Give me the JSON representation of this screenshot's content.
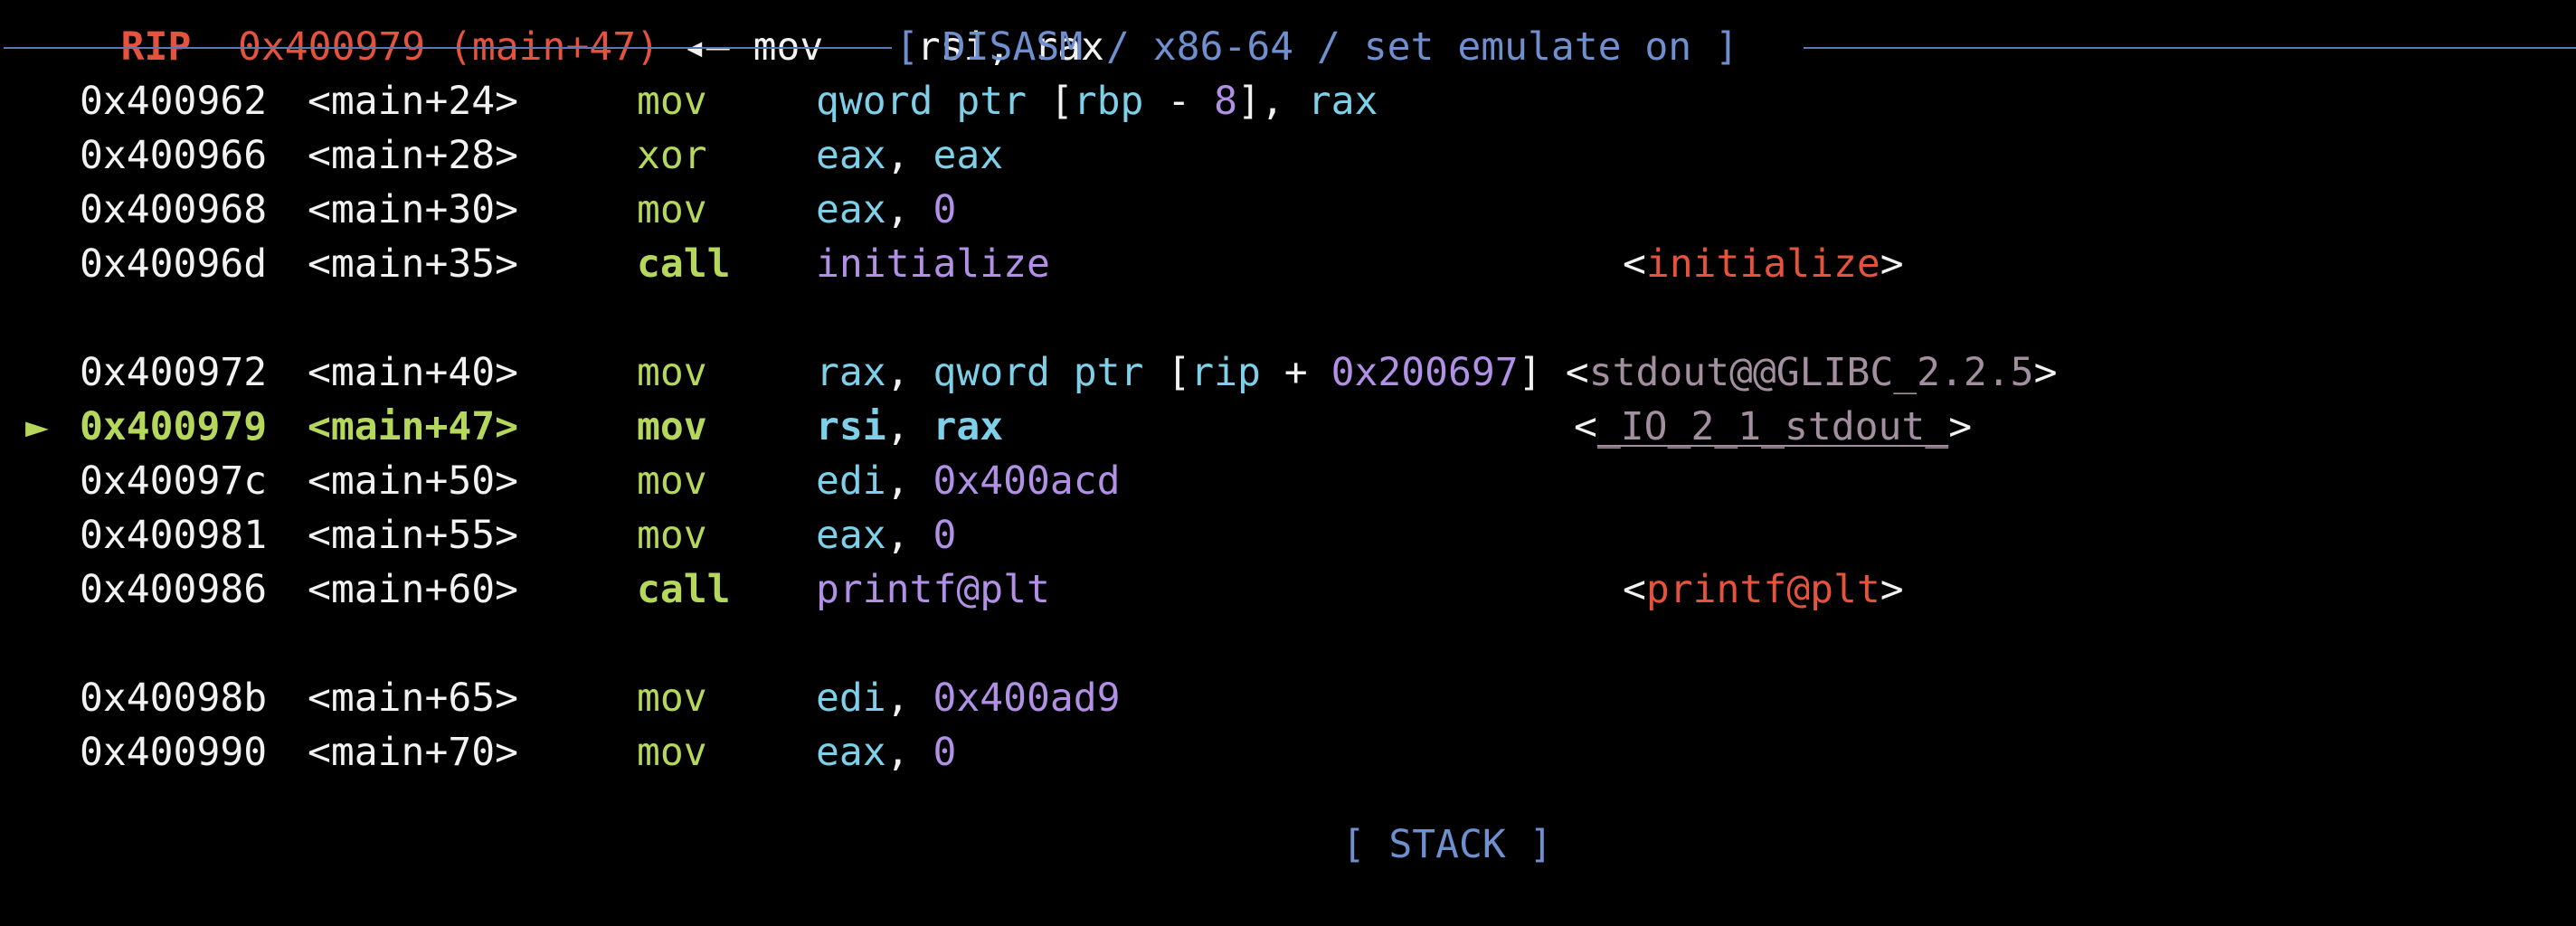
{
  "top_partial": {
    "reg": "RIP",
    "addr_sym": "0x400979 (main+47)",
    "arrow": "◂—",
    "instr": "mov    rsi, rax"
  },
  "banner": {
    "title": "[ DISASM / x86-64 / set emulate on ]"
  },
  "bottom_partial": {
    "title": "[ STACK ]"
  },
  "colors": {
    "background": "#000000",
    "address": "#f2f2f2",
    "mnemonic": "#b5d75c",
    "register": "#7ecfe8",
    "number": "#b190e6",
    "annotation_red": "#e5533d",
    "annotation_grey": "#a38fa0",
    "banner": "#6f8fcf"
  },
  "lines": [
    {
      "addr": "0x400962",
      "sym": "<main+24>",
      "mnemonic": "mov",
      "ops": [
        {
          "t": "qword ptr ",
          "c": "reg"
        },
        {
          "t": "[",
          "c": "punc"
        },
        {
          "t": "rbp",
          "c": "reg"
        },
        {
          "t": " - ",
          "c": "punc"
        },
        {
          "t": "8",
          "c": "num"
        },
        {
          "t": "], ",
          "c": "punc"
        },
        {
          "t": "rax",
          "c": "reg"
        }
      ]
    },
    {
      "addr": "0x400966",
      "sym": "<main+28>",
      "mnemonic": "xor",
      "ops": [
        {
          "t": "eax",
          "c": "reg"
        },
        {
          "t": ", ",
          "c": "punc"
        },
        {
          "t": "eax",
          "c": "reg"
        }
      ]
    },
    {
      "addr": "0x400968",
      "sym": "<main+30>",
      "mnemonic": "mov",
      "ops": [
        {
          "t": "eax",
          "c": "reg"
        },
        {
          "t": ", ",
          "c": "punc"
        },
        {
          "t": "0",
          "c": "num"
        }
      ]
    },
    {
      "addr": "0x40096d",
      "sym": "<main+35>",
      "mnemonic": "call",
      "mn_bold": true,
      "ops": [
        {
          "t": "initialize",
          "c": "sym"
        }
      ],
      "ann": [
        {
          "t": "<",
          "c": "plain"
        },
        {
          "t": "initialize",
          "c": "ann-red"
        },
        {
          "t": ">",
          "c": "plain"
        }
      ]
    },
    {
      "blank": true
    },
    {
      "addr": "0x400972",
      "sym": "<main+40>",
      "mnemonic": "mov",
      "ops": [
        {
          "t": "rax",
          "c": "reg"
        },
        {
          "t": ", ",
          "c": "punc"
        },
        {
          "t": "qword ptr ",
          "c": "reg"
        },
        {
          "t": "[",
          "c": "punc"
        },
        {
          "t": "rip",
          "c": "reg"
        },
        {
          "t": " + ",
          "c": "punc"
        },
        {
          "t": "0x200697",
          "c": "num"
        },
        {
          "t": "] ",
          "c": "punc"
        }
      ],
      "ann_inline": true,
      "ann": [
        {
          "t": "<",
          "c": "plain"
        },
        {
          "t": "stdout@@GLIBC_2.2.5",
          "c": "ann-grey"
        },
        {
          "t": ">",
          "c": "plain"
        }
      ]
    },
    {
      "addr": "0x400979",
      "sym": "<main+47>",
      "mnemonic": "mov",
      "current": true,
      "arrow": "►",
      "ops": [
        {
          "t": "rsi",
          "c": "cur-reg"
        },
        {
          "t": ", ",
          "c": "punc"
        },
        {
          "t": "rax",
          "c": "cur-reg"
        }
      ],
      "ann": [
        {
          "t": "<",
          "c": "plain"
        },
        {
          "t": "_IO_2_1_stdout_",
          "c": "ann-grey-ul"
        },
        {
          "t": ">",
          "c": "plain"
        }
      ],
      "ann_shift": true
    },
    {
      "addr": "0x40097c",
      "sym": "<main+50>",
      "mnemonic": "mov",
      "ops": [
        {
          "t": "edi",
          "c": "reg"
        },
        {
          "t": ", ",
          "c": "punc"
        },
        {
          "t": "0x400acd",
          "c": "num"
        }
      ]
    },
    {
      "addr": "0x400981",
      "sym": "<main+55>",
      "mnemonic": "mov",
      "ops": [
        {
          "t": "eax",
          "c": "reg"
        },
        {
          "t": ", ",
          "c": "punc"
        },
        {
          "t": "0",
          "c": "num"
        }
      ]
    },
    {
      "addr": "0x400986",
      "sym": "<main+60>",
      "mnemonic": "call",
      "mn_bold": true,
      "ops": [
        {
          "t": "printf@plt",
          "c": "sym"
        }
      ],
      "ann": [
        {
          "t": "<",
          "c": "plain"
        },
        {
          "t": "printf@plt",
          "c": "ann-red"
        },
        {
          "t": ">",
          "c": "plain"
        }
      ]
    },
    {
      "blank": true
    },
    {
      "addr": "0x40098b",
      "sym": "<main+65>",
      "mnemonic": "mov",
      "ops": [
        {
          "t": "edi",
          "c": "reg"
        },
        {
          "t": ", ",
          "c": "punc"
        },
        {
          "t": "0x400ad9",
          "c": "num"
        }
      ]
    },
    {
      "addr": "0x400990",
      "sym": "<main+70>",
      "mnemonic": "mov",
      "ops": [
        {
          "t": "eax",
          "c": "reg"
        },
        {
          "t": ", ",
          "c": "punc"
        },
        {
          "t": "0",
          "c": "num"
        }
      ]
    }
  ]
}
